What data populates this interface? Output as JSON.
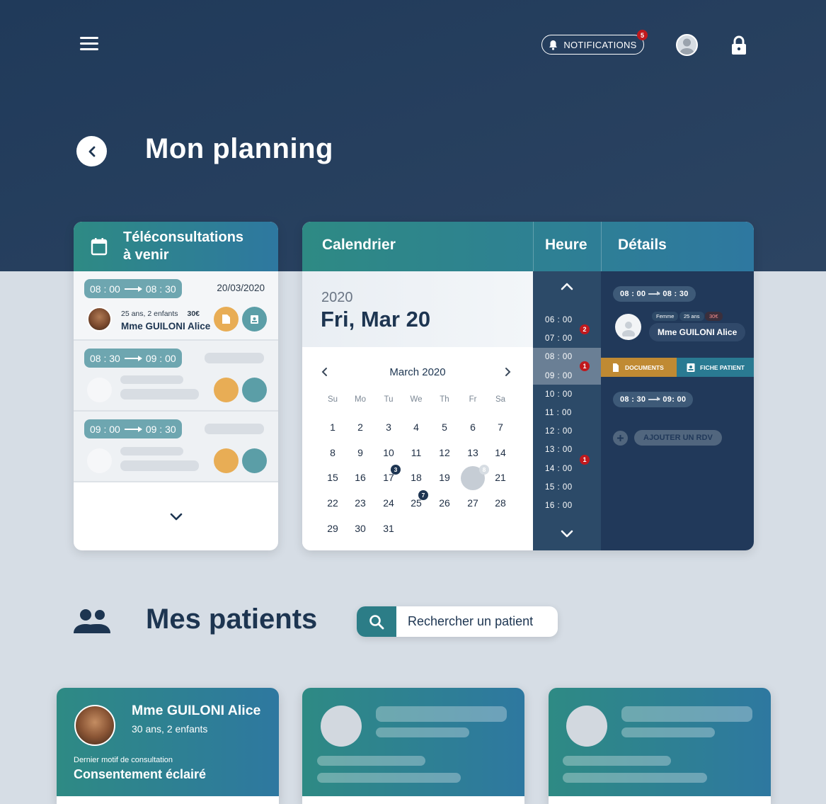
{
  "topbar": {
    "notifications_label": "NOTIFICATIONS",
    "notifications_count": "5"
  },
  "page": {
    "title": "Mon planning"
  },
  "upcoming": {
    "title_line1": "Téléconsultations",
    "title_line2": "à venir",
    "items": [
      {
        "start": "08 : 00",
        "end": "08 : 30",
        "date": "20/03/2020",
        "info": "25 ans, 2 enfants",
        "price": "30€",
        "name": "Mme GUILONI Alice"
      },
      {
        "start": "08 : 30",
        "end": "09 : 00"
      },
      {
        "start": "09 : 00",
        "end": "09 : 30"
      }
    ]
  },
  "calendar": {
    "header": "Calendrier",
    "year": "2020",
    "selected_date": "Fri, Mar 20",
    "month_label": "March 2020",
    "weekdays": [
      "Su",
      "Mo",
      "Tu",
      "We",
      "Th",
      "Fr",
      "Sa"
    ],
    "weeks": [
      [
        "",
        "",
        "",
        "",
        "",
        "",
        ""
      ],
      [
        "1",
        "2",
        "3",
        "4",
        "5",
        "6",
        "7"
      ],
      [
        "8",
        "9",
        "10",
        "11",
        "12",
        "13",
        "14"
      ],
      [
        "15",
        "16",
        "17",
        "18",
        "19",
        "20",
        "21"
      ],
      [
        "22",
        "23",
        "24",
        "25",
        "26",
        "27",
        "28"
      ],
      [
        "29",
        "30",
        "31",
        "",
        "",
        "",
        ""
      ]
    ],
    "badges": {
      "17": "3",
      "25": "7",
      "20": "8"
    },
    "selected_day": "20"
  },
  "hours": {
    "header": "Heure",
    "list": [
      "06 : 00",
      "07 : 00",
      "08 : 00",
      "09 : 00",
      "10 : 00",
      "11 : 00",
      "12 : 00",
      "13 : 00",
      "14 : 00",
      "15 : 00",
      "16 : 00"
    ],
    "badges": [
      {
        "label": "2"
      },
      {
        "label": "1"
      },
      {
        "label": "1"
      }
    ]
  },
  "details": {
    "header": "Détails",
    "slot1_start": "08 : 00",
    "slot1_end": "08 : 30",
    "gender": "Femme",
    "age": "25 ans",
    "price": "30€",
    "patient_name": "Mme GUILONI Alice",
    "documents_label": "DOCUMENTS",
    "fiche_label": "FICHE PATIENT",
    "slot2_start": "08 : 30",
    "slot2_end": "09: 00",
    "add_label": "AJOUTER UN RDV"
  },
  "patients": {
    "title": "Mes patients",
    "search_placeholder": "Rechercher un patient",
    "cards": [
      {
        "name": "Mme GUILONI Alice",
        "info": "30 ans, 2 enfants",
        "last_reason_label": "Dernier motif de consultation",
        "last_reason": "Consentement éclairé"
      }
    ]
  },
  "colors": {
    "navy": "#203a5a",
    "teal": "#2e8a84",
    "orange": "#e8ad55",
    "badge_red": "#c0191d"
  }
}
